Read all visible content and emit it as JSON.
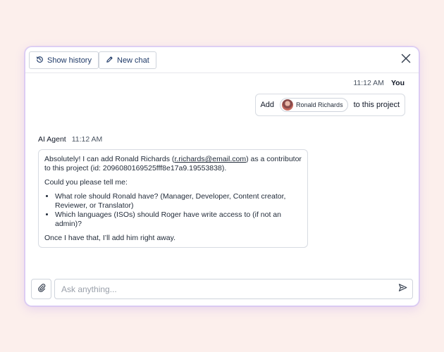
{
  "toolbar": {
    "history_label": "Show history",
    "new_chat_label": "New chat"
  },
  "user_message": {
    "time": "11:12 AM",
    "author": "You",
    "prefix": "Add",
    "mention_name": "Ronald Richards",
    "suffix": "to this project"
  },
  "agent_message": {
    "author": "AI Agent",
    "time": "11:12 AM",
    "para1_start": "Absolutely! I can add Ronald Richards (",
    "email": "r.richards@email.com",
    "para1_end": ") as a contributor to this project (id: 2096080169525fff8e17a9.19553838).",
    "para2": "Could you please tell me:",
    "bullets": [
      "What role should Ronald have? (Manager, Developer, Content creator, Reviewer, or Translator)",
      "Which languages (ISOs) should Roger have write access to (if not an admin)?"
    ],
    "para3": "Once I have that, I’ll add him right away."
  },
  "composer": {
    "placeholder": "Ask anything..."
  },
  "icons": {
    "history": "history-icon",
    "new_chat": "pencil-icon",
    "close": "close-icon",
    "attach": "paperclip-icon",
    "send": "send-icon"
  },
  "colors": {
    "background": "#fcefec",
    "accent_border": "#a78bfa",
    "button_text": "#1f3a68"
  }
}
